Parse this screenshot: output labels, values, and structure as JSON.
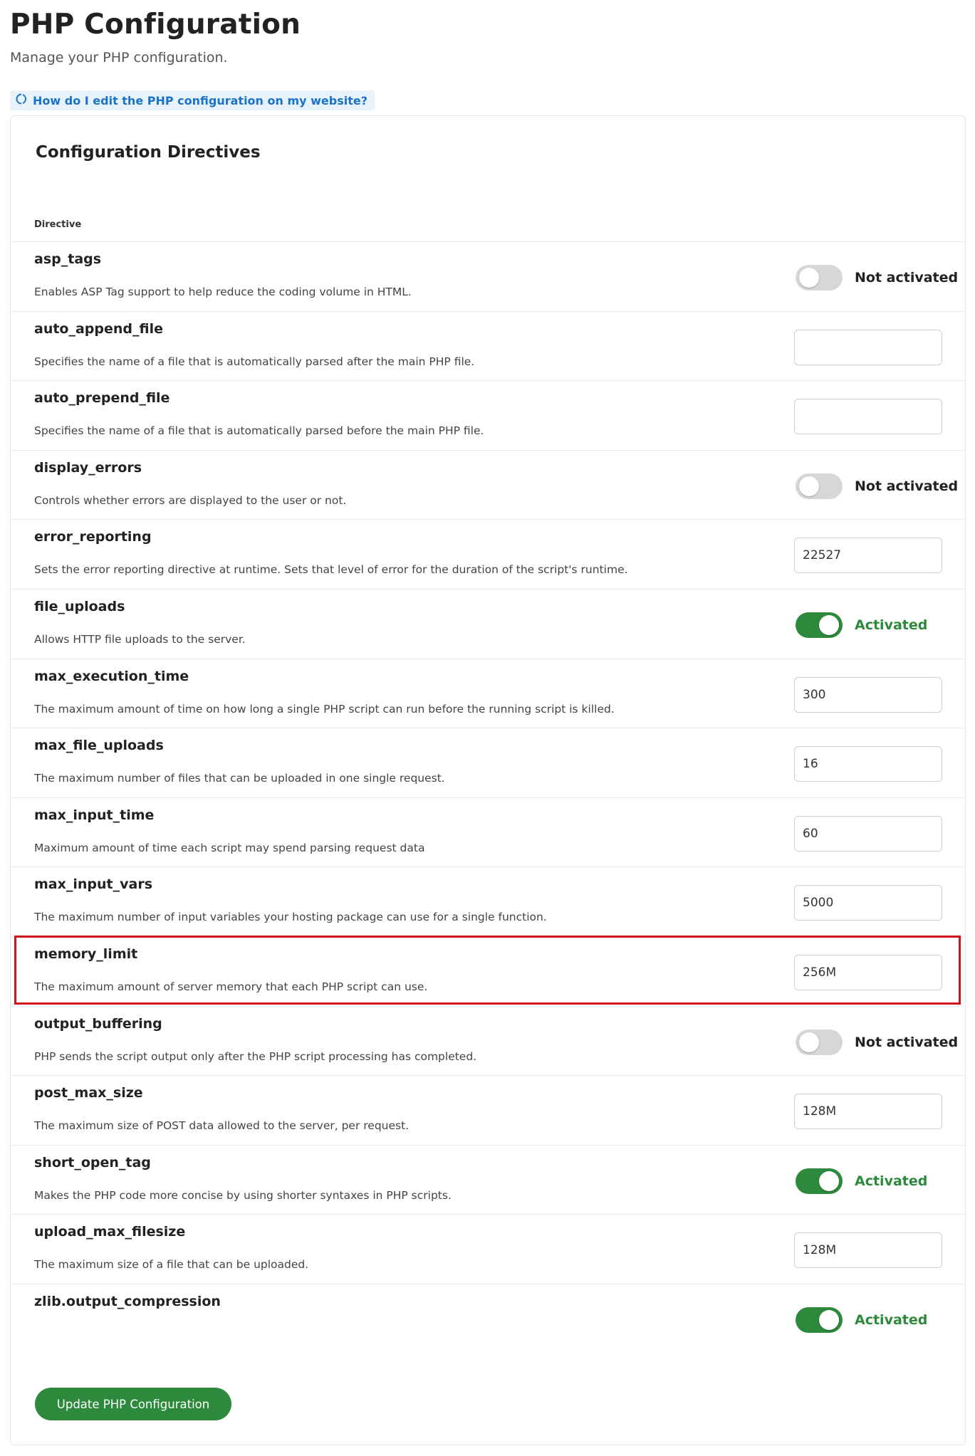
{
  "header": {
    "title": "PHP Configuration",
    "subtitle": "Manage your PHP configuration."
  },
  "help": {
    "link_label": "How do I edit the PHP configuration on my website?",
    "icon": "spinner-circle-icon"
  },
  "card": {
    "title": "Configuration Directives",
    "column_header": "Directive"
  },
  "directives": [
    {
      "name": "asp_tags",
      "description": "Enables ASP Tag support to help reduce the coding volume in HTML.",
      "type": "toggle",
      "active": false,
      "status_label": "Not activated"
    },
    {
      "name": "auto_append_file",
      "description": "Specifies the name of a file that is automatically parsed after the main PHP file.",
      "type": "input",
      "value": ""
    },
    {
      "name": "auto_prepend_file",
      "description": "Specifies the name of a file that is automatically parsed before the main PHP file.",
      "type": "input",
      "value": ""
    },
    {
      "name": "display_errors",
      "description": "Controls whether errors are displayed to the user or not.",
      "type": "toggle",
      "active": false,
      "status_label": "Not activated"
    },
    {
      "name": "error_reporting",
      "description": "Sets the error reporting directive at runtime. Sets that level of error for the duration of the script's runtime.",
      "type": "input",
      "value": "22527"
    },
    {
      "name": "file_uploads",
      "description": "Allows HTTP file uploads to the server.",
      "type": "toggle",
      "active": true,
      "status_label": "Activated"
    },
    {
      "name": "max_execution_time",
      "description": "The maximum amount of time on how long a single PHP script can run before the running script is killed.",
      "type": "input",
      "value": "300"
    },
    {
      "name": "max_file_uploads",
      "description": "The maximum number of files that can be uploaded in one single request.",
      "type": "input",
      "value": "16"
    },
    {
      "name": "max_input_time",
      "description": "Maximum amount of time each script may spend parsing request data",
      "type": "input",
      "value": "60"
    },
    {
      "name": "max_input_vars",
      "description": "The maximum number of input variables your hosting package can use for a single function.",
      "type": "input",
      "value": "5000"
    },
    {
      "name": "memory_limit",
      "description": "The maximum amount of server memory that each PHP script can use.",
      "type": "input",
      "value": "256M"
    },
    {
      "name": "output_buffering",
      "description": "PHP sends the script output only after the PHP script processing has completed.",
      "type": "toggle",
      "active": false,
      "status_label": "Not activated"
    },
    {
      "name": "post_max_size",
      "description": "The maximum size of POST data allowed to the server, per request.",
      "type": "input",
      "value": "128M"
    },
    {
      "name": "short_open_tag",
      "description": "Makes the PHP code more concise by using shorter syntaxes in PHP scripts.",
      "type": "toggle",
      "active": true,
      "status_label": "Activated"
    },
    {
      "name": "upload_max_filesize",
      "description": "The maximum size of a file that can be uploaded.",
      "type": "input",
      "value": "128M"
    },
    {
      "name": "zlib.output_compression",
      "description": "",
      "type": "toggle",
      "active": true,
      "status_label": "Activated"
    }
  ],
  "actions": {
    "submit_label": "Update PHP Configuration"
  },
  "colors": {
    "accent_green": "#2d8a3c",
    "link_blue": "#1a73c8",
    "highlight_red": "#d0121a",
    "toggle_off": "#d7d7d7"
  }
}
